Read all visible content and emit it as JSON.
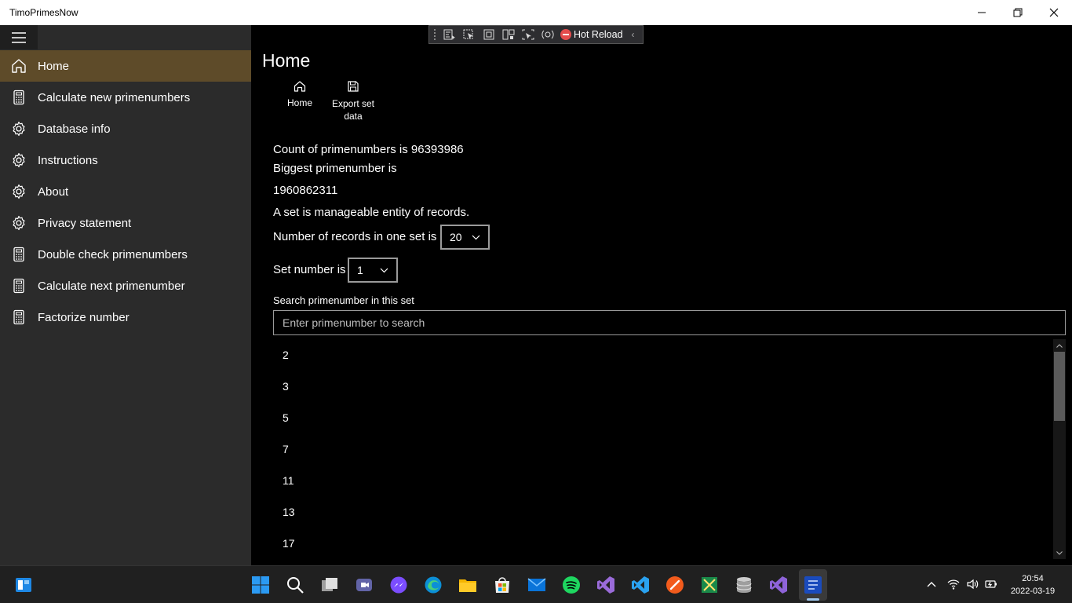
{
  "window": {
    "title": "TimoPrimesNow"
  },
  "sidebar": {
    "items": [
      {
        "label": "Home",
        "icon": "home-icon"
      },
      {
        "label": "Calculate new primenumbers",
        "icon": "calculator-icon"
      },
      {
        "label": "Database info",
        "icon": "gear-icon"
      },
      {
        "label": "Instructions",
        "icon": "gear-icon"
      },
      {
        "label": "About",
        "icon": "gear-icon"
      },
      {
        "label": "Privacy statement",
        "icon": "gear-icon"
      },
      {
        "label": "Double check primenumbers",
        "icon": "calculator-icon"
      },
      {
        "label": "Calculate next primenumber",
        "icon": "calculator-icon"
      },
      {
        "label": "Factorize number",
        "icon": "calculator-icon"
      }
    ],
    "selected": "Home"
  },
  "hotreload": {
    "label": "Hot Reload"
  },
  "main": {
    "title": "Home",
    "commands": {
      "home": "Home",
      "export_line1": "Export set",
      "export_line2": "data"
    },
    "count_text": "Count of primenumbers is 96393986",
    "biggest_label": "Biggest primenumber is",
    "biggest_value": "1960862311",
    "set_info": "A set is manageable entity of records.",
    "records_label": "Number of records in one set is",
    "records_value": "20",
    "set_label": "Set number is",
    "set_value": "1",
    "search_label": "Search primenumber in this set",
    "search_placeholder": "Enter primenumber to search",
    "search_value": "",
    "list": [
      "2",
      "3",
      "5",
      "7",
      "11",
      "13",
      "17"
    ]
  },
  "taskbar": {
    "time": "20:54",
    "date": "2022-03-19"
  },
  "colors": {
    "selected_nav": "#5e4b29",
    "sidebar_bg": "#2b2b2b",
    "accent": "#0078d4"
  }
}
